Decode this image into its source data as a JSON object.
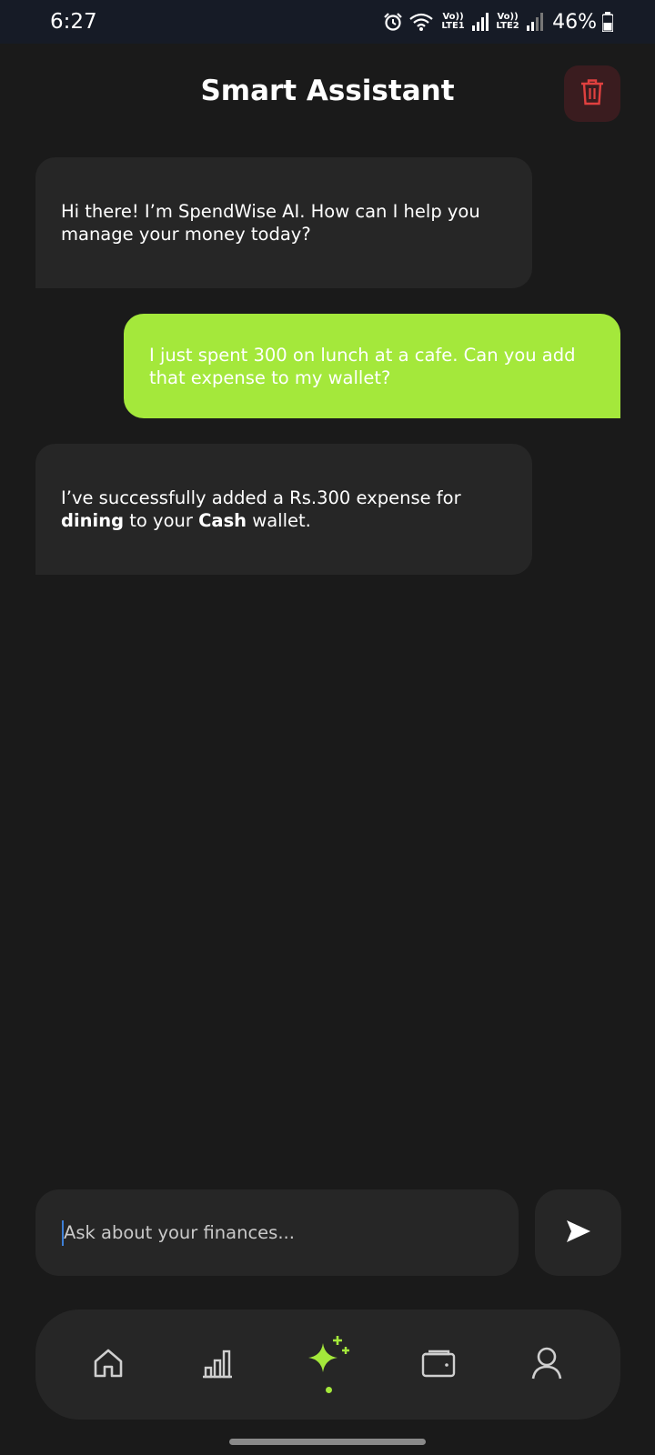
{
  "status_bar": {
    "time": "6:27",
    "network1": "Vo)) LTE1",
    "network2": "Vo)) LTE2",
    "battery": "46%",
    "icons": [
      "alarm-icon",
      "wifi-icon",
      "signal-icon",
      "battery-icon"
    ]
  },
  "header": {
    "title": "Smart Assistant",
    "delete_icon": "trash-icon"
  },
  "messages": [
    {
      "role": "assistant",
      "text": "Hi there! I’m SpendWise AI. How can I help you manage your money today?"
    },
    {
      "role": "user",
      "text": "I just spent 300 on lunch at a cafe. Can you add that expense to my wallet?"
    },
    {
      "role": "assistant",
      "part1": "I’ve successfully added a Rs.300 expense for ",
      "bold1": "dining",
      "part2": " to your ",
      "bold2": "Cash",
      "part3": " wallet."
    }
  ],
  "composer": {
    "placeholder": "Ask about your finances...",
    "value": "",
    "send_icon": "send-icon"
  },
  "nav": {
    "items": [
      {
        "icon": "home-icon",
        "active": false
      },
      {
        "icon": "stats-icon",
        "active": false
      },
      {
        "icon": "sparkle-icon",
        "active": true
      },
      {
        "icon": "wallet-icon",
        "active": false
      },
      {
        "icon": "profile-icon",
        "active": false
      }
    ]
  },
  "colors": {
    "background": "#1a1a1a",
    "bubble_assistant": "#262626",
    "bubble_user": "#a4e83b",
    "accent": "#a4e83b",
    "danger": "#e0403f"
  }
}
